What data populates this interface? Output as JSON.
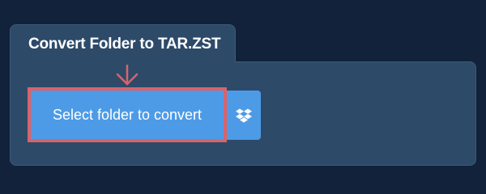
{
  "panel": {
    "title": "Convert Folder to TAR.ZST"
  },
  "actions": {
    "select_label": "Select folder to convert",
    "dropbox_icon": "dropbox-icon"
  },
  "colors": {
    "background": "#11223a",
    "panel": "#2d4a69",
    "button": "#4d9be6",
    "highlight": "#d9636a"
  }
}
